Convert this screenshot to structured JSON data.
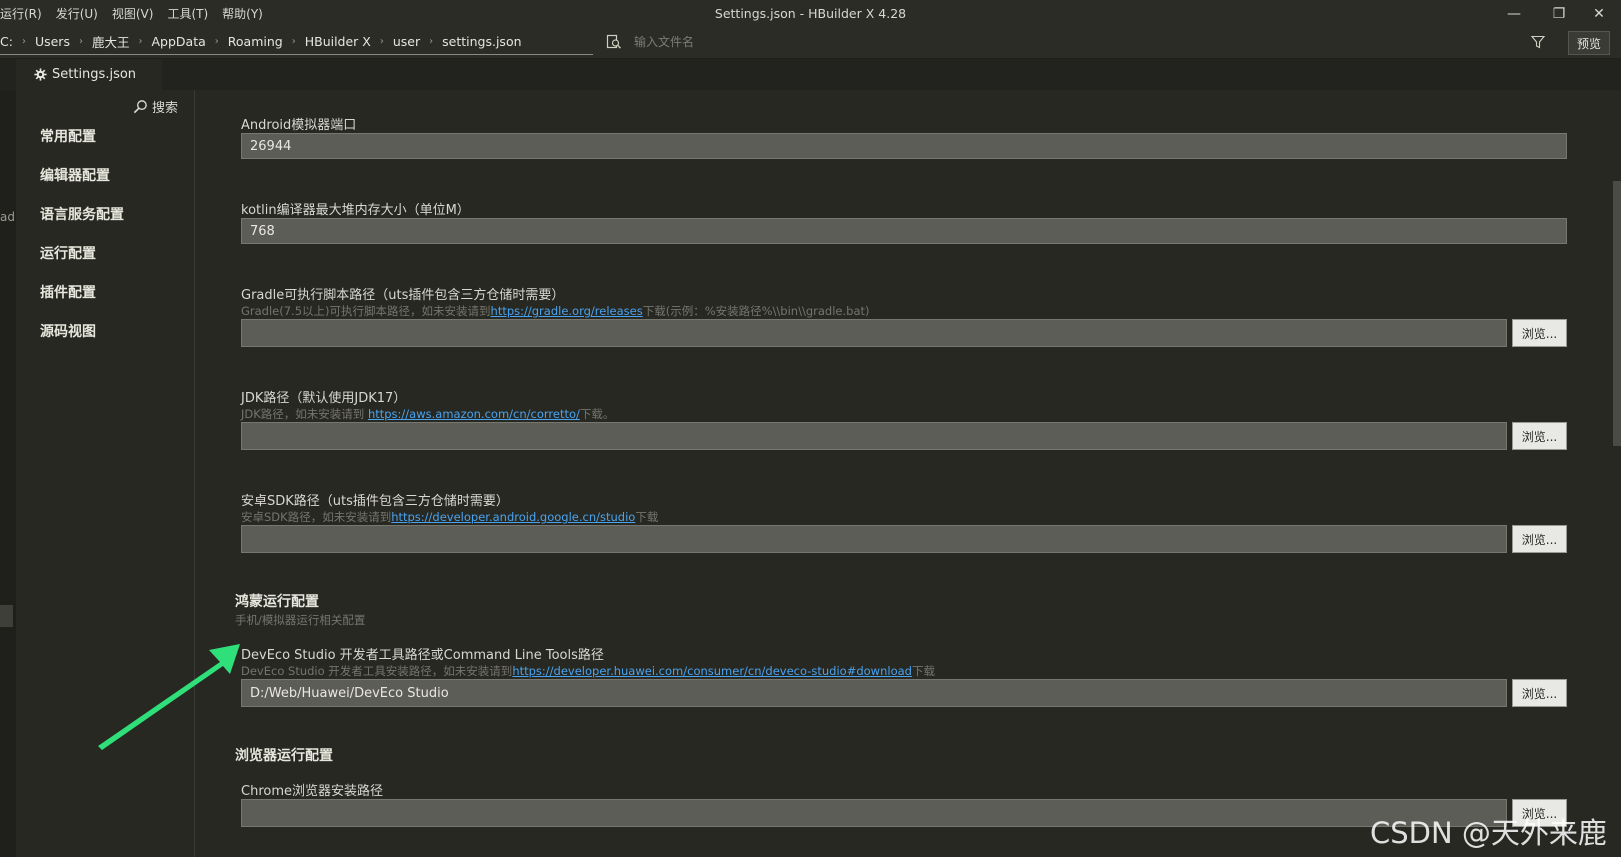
{
  "titlebar": {
    "menus": [
      "运行(R)",
      "发行(U)",
      "视图(V)",
      "工具(T)",
      "帮助(Y)"
    ],
    "window_title": "Settings.json - HBuilder X 4.28",
    "controls": {
      "minimize": "—",
      "restore": "❐",
      "close": "✕"
    }
  },
  "address": {
    "breadcrumb": [
      "C:",
      "Users",
      "鹿大王",
      "AppData",
      "Roaming",
      "HBuilder X",
      "user",
      "settings.json"
    ],
    "separator": "›",
    "file_search_placeholder": "输入文件名",
    "preview_label": "预览"
  },
  "tab": {
    "label": "Settings.json",
    "icon": "gear-icon"
  },
  "left_strip": {
    "label": "adr"
  },
  "sidebar": {
    "search_label": "搜索",
    "items": [
      "常用配置",
      "编辑器配置",
      "语言服务配置",
      "运行配置",
      "插件配置",
      "源码视图"
    ]
  },
  "fields": {
    "android_port": {
      "label": "Android模拟器端口",
      "value": "26944"
    },
    "kotlin_heap": {
      "label": "kotlin编译器最大堆内存大小（单位M）",
      "value": "768"
    },
    "gradle": {
      "label": "Gradle可执行脚本路径（uts插件包含三方仓储时需要）",
      "desc_prefix": "Gradle(7.5以上)可执行脚本路径，如未安装请到",
      "desc_link": "https://gradle.org/releases",
      "desc_suffix": "下载(示例：%安装路径%\\\\bin\\\\gradle.bat)",
      "value": ""
    },
    "jdk": {
      "label": "JDK路径（默认使用JDK17）",
      "desc_prefix": "JDK路径，如未安装请到 ",
      "desc_link": "https://aws.amazon.com/cn/corretto/",
      "desc_suffix": "下载。",
      "value": ""
    },
    "android_sdk": {
      "label": "安卓SDK路径（uts插件包含三方仓储时需要）",
      "desc_prefix": "安卓SDK路径，如未安装请到",
      "desc_link": "https://developer.android.google.cn/studio",
      "desc_suffix": "下载",
      "value": ""
    },
    "deveco": {
      "label": "DevEco Studio 开发者工具路径或Command Line Tools路径",
      "desc_prefix": "DevEco Studio 开发者工具安装路径，如未安装请到",
      "desc_link": "https://developer.huawei.com/consumer/cn/deveco-studio#download",
      "desc_suffix": "下载",
      "value": "D:/Web/Huawei/DevEco Studio"
    },
    "chrome": {
      "label": "Chrome浏览器安装路径",
      "value": ""
    }
  },
  "sections": {
    "harmony": {
      "title": "鸿蒙运行配置",
      "subtitle": "手机/模拟器运行相关配置"
    },
    "browser": {
      "title": "浏览器运行配置"
    }
  },
  "browse_label": "浏览...",
  "watermark": "CSDN @天外来鹿",
  "colors": {
    "accent_link": "#4aa3f0",
    "arrow": "#2fe07a",
    "background": "#272822"
  }
}
